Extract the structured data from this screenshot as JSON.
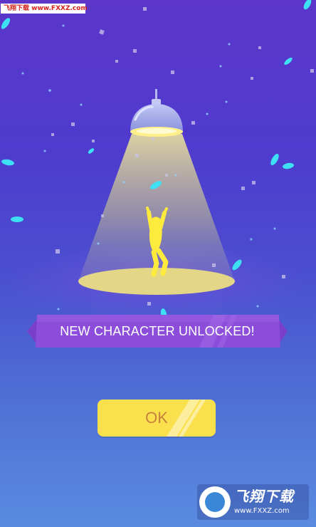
{
  "watermark_top": {
    "text": "飞翔下载 www.FXXZ.com"
  },
  "banner": {
    "text": "NEW CHARACTER UNLOCKED!"
  },
  "ok_button": {
    "label": "OK"
  },
  "watermark_bottom": {
    "title": "飞翔下载",
    "url": "www.FXXZ.com"
  },
  "colors": {
    "background_top": "#5b36c9",
    "background_bottom": "#5a8be0",
    "lamp": "#a9b1ee",
    "light_beam": "#e7e38a",
    "character": "#fcea3c",
    "banner": "#8a4bd9",
    "button": "#fbe04d",
    "button_text": "#c8813c",
    "leaf": "#3ee0f4"
  }
}
